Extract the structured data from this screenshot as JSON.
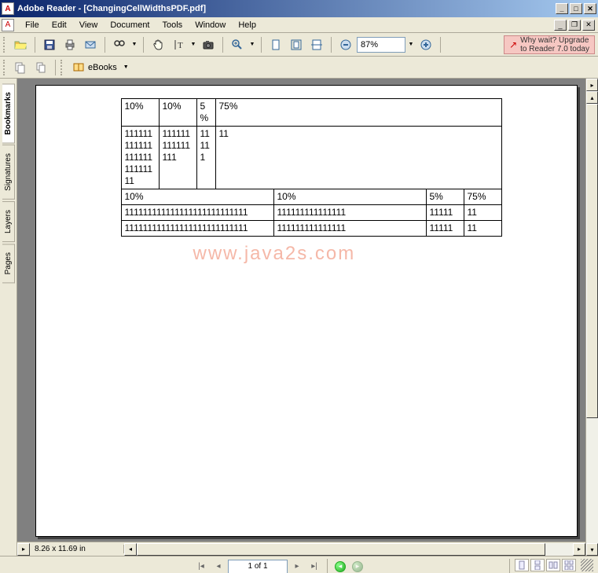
{
  "titlebar": {
    "title": "Adobe Reader - [ChangingCellWidthsPDF.pdf]"
  },
  "menus": {
    "file": "File",
    "edit": "Edit",
    "view": "View",
    "document": "Document",
    "tools": "Tools",
    "window": "Window",
    "help": "Help"
  },
  "toolbar": {
    "zoom_value": "87%",
    "promo_line1": "Why wait? Upgrade",
    "promo_line2": "to Reader 7.0 today",
    "ebooks_label": "eBooks"
  },
  "nav_tabs": {
    "bookmarks": "Bookmarks",
    "signatures": "Signatures",
    "layers": "Layers",
    "pages": "Pages"
  },
  "page_content": {
    "table1": {
      "r1": {
        "c1": "10%",
        "c2": "10%",
        "c3": "5%",
        "c4": "75%"
      },
      "r2": {
        "c1": "11111111111111111111111111",
        "c2": "111111111111111",
        "c3": "11111",
        "c4": "11"
      }
    },
    "table2": {
      "r1": {
        "c1": "10%",
        "c2": "10%",
        "c3": "5%",
        "c4": "75%"
      },
      "r2": {
        "c1": "111111111111111111111111111",
        "c2": "111111111111111",
        "c3": "11111",
        "c4": "11"
      },
      "r3": {
        "c1": "111111111111111111111111111",
        "c2": "111111111111111",
        "c3": "11111",
        "c4": "11"
      }
    },
    "watermark": "www.java2s.com"
  },
  "status": {
    "dims": "8.26 x 11.69 in",
    "page_display": "1 of 1"
  }
}
